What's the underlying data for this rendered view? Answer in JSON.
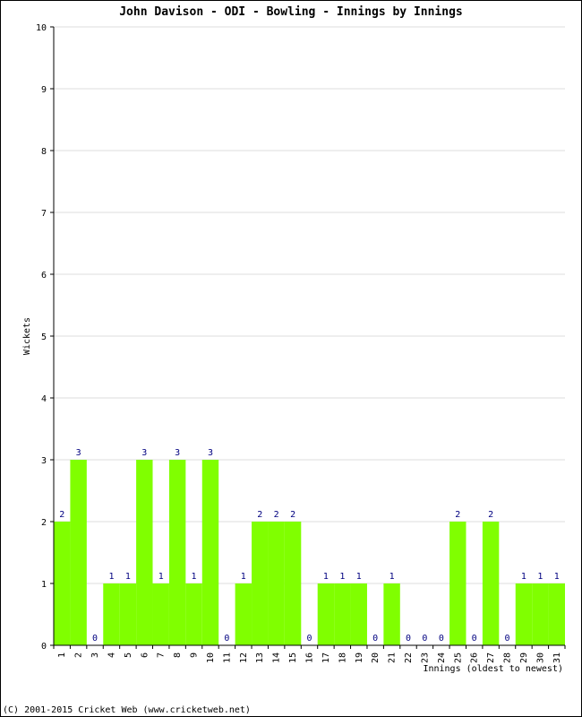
{
  "chart_data": {
    "type": "bar",
    "title": "John Davison - ODI - Bowling - Innings by Innings",
    "xlabel": "Innings (oldest to newest)",
    "ylabel": "Wickets",
    "ylim": [
      0,
      10
    ],
    "yticks": [
      "0",
      "1",
      "2",
      "3",
      "4",
      "5",
      "6",
      "7",
      "8",
      "9",
      "10"
    ],
    "grid": true,
    "bar_color": "#80ff00",
    "label_color": "#000080",
    "categories": [
      "1",
      "2",
      "3",
      "4",
      "5",
      "6",
      "7",
      "8",
      "9",
      "10",
      "11",
      "12",
      "13",
      "14",
      "15",
      "16",
      "17",
      "18",
      "19",
      "20",
      "21",
      "22",
      "23",
      "24",
      "25",
      "26",
      "27",
      "28",
      "29",
      "30",
      "31"
    ],
    "values": [
      2,
      3,
      0,
      1,
      1,
      3,
      1,
      3,
      1,
      3,
      0,
      1,
      2,
      2,
      2,
      0,
      1,
      1,
      1,
      0,
      1,
      0,
      0,
      0,
      2,
      0,
      2,
      0,
      1,
      1,
      1
    ]
  },
  "footer": "(C) 2001-2015 Cricket Web (www.cricketweb.net)"
}
